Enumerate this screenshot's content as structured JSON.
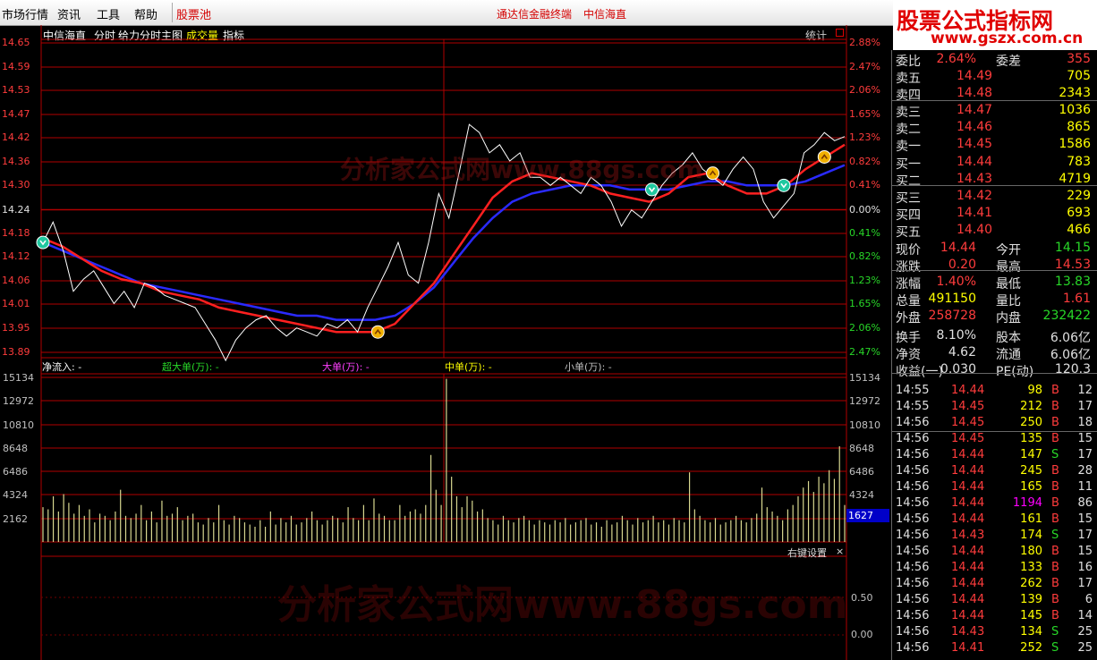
{
  "menu": {
    "items": [
      "市场行情",
      "资讯",
      "工具",
      "帮助"
    ],
    "stock_pool": "股票池",
    "center_left": "通达信金融终端",
    "center_right": "中信海直"
  },
  "logo": {
    "line1": "股票公式指标网",
    "line2": "www.gszx.com.cn"
  },
  "watermark": {
    "top": "分析家公式网www.88gs.com",
    "bottom": "分析家公式网www.88gs.com"
  },
  "chart_header": {
    "stock": "中信海直",
    "mode": "分时",
    "main": "给力分时主图",
    "volume": "成交量",
    "indicator": "指标",
    "stats": "统计"
  },
  "colors": {
    "up": "#ff3c3c",
    "down": "#28d828",
    "price_line": "#ffffff",
    "avg_red": "#ff2020",
    "avg_blue": "#2020ff",
    "grid": "#b00000"
  },
  "chart_data": {
    "type": "line",
    "price_axis": [
      "14.65",
      "14.59",
      "14.53",
      "14.47",
      "14.42",
      "14.36",
      "14.30",
      "14.24",
      "14.18",
      "14.12",
      "14.06",
      "14.01",
      "13.95",
      "13.89"
    ],
    "pct_axis": [
      "2.88%",
      "2.47%",
      "2.06%",
      "1.65%",
      "1.23%",
      "0.82%",
      "0.41%",
      "0.00%",
      "0.41%",
      "0.82%",
      "1.23%",
      "1.65%",
      "2.06%",
      "2.47%"
    ],
    "ylim": [
      13.89,
      14.65
    ],
    "base_price": 14.24,
    "price": [
      14.16,
      14.21,
      14.14,
      14.04,
      14.07,
      14.09,
      14.05,
      14.01,
      14.04,
      14.0,
      14.06,
      14.05,
      14.03,
      14.02,
      14.01,
      14.0,
      13.96,
      13.92,
      13.87,
      13.92,
      13.95,
      13.97,
      13.98,
      13.95,
      13.93,
      13.95,
      13.94,
      13.93,
      13.96,
      13.95,
      13.97,
      13.94,
      14.0,
      14.05,
      14.1,
      14.16,
      14.08,
      14.06,
      14.16,
      14.28,
      14.22,
      14.33,
      14.45,
      14.43,
      14.38,
      14.4,
      14.36,
      14.38,
      14.32,
      14.32,
      14.3,
      14.32,
      14.3,
      14.28,
      14.32,
      14.3,
      14.26,
      14.2,
      14.24,
      14.22,
      14.26,
      14.3,
      14.33,
      14.35,
      14.38,
      14.34,
      14.32,
      14.3,
      14.34,
      14.37,
      14.34,
      14.26,
      14.22,
      14.25,
      14.28,
      14.38,
      14.4,
      14.43,
      14.41,
      14.42
    ],
    "avg_red": [
      14.17,
      14.15,
      14.12,
      14.09,
      14.07,
      14.06,
      14.04,
      14.03,
      14.02,
      14.0,
      13.99,
      13.98,
      13.97,
      13.96,
      13.95,
      13.94,
      13.94,
      13.94,
      13.96,
      14.01,
      14.06,
      14.13,
      14.2,
      14.27,
      14.31,
      14.33,
      14.32,
      14.31,
      14.3,
      14.28,
      14.27,
      14.26,
      14.28,
      14.32,
      14.33,
      14.3,
      14.28,
      14.28,
      14.3,
      14.34,
      14.37,
      14.4
    ],
    "avg_blue": [
      14.16,
      14.14,
      14.12,
      14.1,
      14.08,
      14.06,
      14.05,
      14.04,
      14.03,
      14.02,
      14.01,
      14.0,
      13.99,
      13.98,
      13.98,
      13.97,
      13.97,
      13.97,
      13.98,
      14.01,
      14.05,
      14.11,
      14.17,
      14.22,
      14.26,
      14.28,
      14.29,
      14.3,
      14.3,
      14.3,
      14.29,
      14.29,
      14.29,
      14.3,
      14.31,
      14.31,
      14.3,
      14.3,
      14.3,
      14.31,
      14.33,
      14.35
    ],
    "signals": [
      {
        "i": 0,
        "kind": "down"
      },
      {
        "i": 33,
        "kind": "up"
      },
      {
        "i": 60,
        "kind": "down"
      },
      {
        "i": 66,
        "kind": "up"
      },
      {
        "i": 73,
        "kind": "down"
      },
      {
        "i": 77,
        "kind": "up"
      }
    ],
    "volume_axis": [
      "15134",
      "12972",
      "10810",
      "8648",
      "6486",
      "4324",
      "2162"
    ],
    "volume_last": "1627",
    "volume": [
      3200,
      3000,
      4200,
      2800,
      4400,
      3600,
      2600,
      3400,
      2400,
      3000,
      1800,
      2600,
      2400,
      2000,
      2800,
      4800,
      2400,
      2200,
      2600,
      3400,
      2000,
      2800,
      1800,
      3800,
      2400,
      2600,
      3200,
      2000,
      2400,
      2600,
      1800,
      1600,
      2200,
      1800,
      3400,
      2000,
      1600,
      2400,
      2200,
      1800,
      1600,
      1400,
      2000,
      1400,
      2800,
      1600,
      2200,
      1800,
      2400,
      1600,
      1800,
      2200,
      2800,
      2000,
      1600,
      2000,
      2400,
      2200,
      1800,
      3200,
      2200,
      2000,
      3400,
      2000,
      4000,
      2600,
      2400,
      2000,
      2000,
      3400,
      2400,
      2800,
      3000,
      2600,
      3400,
      8000,
      4800,
      3400,
      15000,
      6000,
      4200,
      3200,
      4200,
      3800,
      2800,
      3000,
      2200,
      2000,
      1600,
      2400,
      2000,
      1800,
      2200,
      2400,
      2000,
      1600,
      2000,
      1800,
      1600,
      2000,
      1800,
      2200,
      1600,
      1800,
      2000,
      2200,
      1600,
      1800,
      1400,
      2000,
      1600,
      1800,
      2400,
      2000,
      1600,
      2200,
      1800,
      2000,
      2400,
      1800,
      2000,
      1600,
      2200,
      2000,
      1800,
      6400,
      3000,
      2400,
      2000,
      1800,
      2200,
      1600,
      1800,
      2000,
      2400,
      2000,
      1800,
      2200,
      2600,
      5000,
      3200,
      2800,
      2400,
      2000,
      3000,
      3400,
      4200,
      5000,
      5600,
      4600,
      6000,
      5400,
      6600,
      5800,
      8800,
      3400
    ]
  },
  "flow": {
    "net": "净流入: -",
    "super": "超大单(万): -",
    "big": "大单(万): -",
    "mid": "中单(万): -",
    "small": "小单(万): -"
  },
  "right_click": "右键设置",
  "osc_axis": [
    "0.50",
    "0.00"
  ],
  "order_book": {
    "ratio": {
      "label": "委比",
      "value": "2.64%",
      "label2": "委差",
      "value2": "355"
    },
    "asks": [
      {
        "label": "卖五",
        "price": "14.49",
        "vol": "705"
      },
      {
        "label": "卖四",
        "price": "14.48",
        "vol": "2343"
      },
      {
        "label": "卖三",
        "price": "14.47",
        "vol": "1036"
      },
      {
        "label": "卖二",
        "price": "14.46",
        "vol": "865"
      },
      {
        "label": "卖一",
        "price": "14.45",
        "vol": "1586"
      }
    ],
    "bids": [
      {
        "label": "买一",
        "price": "14.44",
        "vol": "783"
      },
      {
        "label": "买二",
        "price": "14.43",
        "vol": "4719"
      },
      {
        "label": "买三",
        "price": "14.42",
        "vol": "229"
      },
      {
        "label": "买四",
        "price": "14.41",
        "vol": "693"
      },
      {
        "label": "买五",
        "price": "14.40",
        "vol": "466"
      }
    ]
  },
  "quote": [
    {
      "l1": "现价",
      "v1": "14.44",
      "l2": "今开",
      "v2": "14.15",
      "c1": "red",
      "c2": "grn"
    },
    {
      "l1": "涨跌",
      "v1": "0.20",
      "l2": "最高",
      "v2": "14.53",
      "c1": "red",
      "c2": "red"
    },
    {
      "l1": "涨幅",
      "v1": "1.40%",
      "l2": "最低",
      "v2": "13.83",
      "c1": "red",
      "c2": "grn"
    },
    {
      "l1": "总量",
      "v1": "491150",
      "l2": "量比",
      "v2": "1.61",
      "c1": "yel",
      "c2": "red"
    },
    {
      "l1": "外盘",
      "v1": "258728",
      "l2": "内盘",
      "v2": "232422",
      "c1": "red",
      "c2": "grn"
    },
    {
      "l1": "换手",
      "v1": "8.10%",
      "l2": "股本",
      "v2": "6.06亿",
      "c1": "wht",
      "c2": "wht"
    },
    {
      "l1": "净资",
      "v1": "4.62",
      "l2": "流通",
      "v2": "6.06亿",
      "c1": "wht",
      "c2": "wht"
    },
    {
      "l1": "收益(一)",
      "v1": "0.030",
      "l2": "PE(动)",
      "v2": "120.3",
      "c1": "wht",
      "c2": "wht"
    }
  ],
  "ticks": [
    {
      "t": "14:55",
      "p": "14.44",
      "v": "98",
      "s": "B",
      "n": "12",
      "pc": "red",
      "vc": "yel"
    },
    {
      "t": "14:55",
      "p": "14.45",
      "v": "212",
      "s": "B",
      "n": "17",
      "pc": "red",
      "vc": "yel"
    },
    {
      "t": "14:56",
      "p": "14.45",
      "v": "250",
      "s": "B",
      "n": "18",
      "pc": "red",
      "vc": "yel"
    },
    {
      "t": "14:56",
      "p": "14.45",
      "v": "135",
      "s": "B",
      "n": "15",
      "pc": "red",
      "vc": "yel"
    },
    {
      "t": "14:56",
      "p": "14.44",
      "v": "147",
      "s": "S",
      "n": "17",
      "pc": "red",
      "vc": "yel"
    },
    {
      "t": "14:56",
      "p": "14.44",
      "v": "245",
      "s": "B",
      "n": "28",
      "pc": "red",
      "vc": "yel"
    },
    {
      "t": "14:56",
      "p": "14.44",
      "v": "165",
      "s": "B",
      "n": "11",
      "pc": "red",
      "vc": "yel"
    },
    {
      "t": "14:56",
      "p": "14.44",
      "v": "1194",
      "s": "B",
      "n": "86",
      "pc": "red",
      "vc": "mag"
    },
    {
      "t": "14:56",
      "p": "14.44",
      "v": "161",
      "s": "B",
      "n": "15",
      "pc": "red",
      "vc": "yel"
    },
    {
      "t": "14:56",
      "p": "14.43",
      "v": "174",
      "s": "S",
      "n": "17",
      "pc": "red",
      "vc": "yel"
    },
    {
      "t": "14:56",
      "p": "14.44",
      "v": "180",
      "s": "B",
      "n": "15",
      "pc": "red",
      "vc": "yel"
    },
    {
      "t": "14:56",
      "p": "14.44",
      "v": "133",
      "s": "B",
      "n": "16",
      "pc": "red",
      "vc": "yel"
    },
    {
      "t": "14:56",
      "p": "14.44",
      "v": "262",
      "s": "B",
      "n": "17",
      "pc": "red",
      "vc": "yel"
    },
    {
      "t": "14:56",
      "p": "14.44",
      "v": "139",
      "s": "B",
      "n": "6",
      "pc": "red",
      "vc": "yel"
    },
    {
      "t": "14:56",
      "p": "14.44",
      "v": "145",
      "s": "B",
      "n": "14",
      "pc": "red",
      "vc": "yel"
    },
    {
      "t": "14:56",
      "p": "14.43",
      "v": "134",
      "s": "S",
      "n": "25",
      "pc": "red",
      "vc": "yel"
    },
    {
      "t": "14:56",
      "p": "14.41",
      "v": "252",
      "s": "S",
      "n": "25",
      "pc": "red",
      "vc": "yel"
    }
  ]
}
